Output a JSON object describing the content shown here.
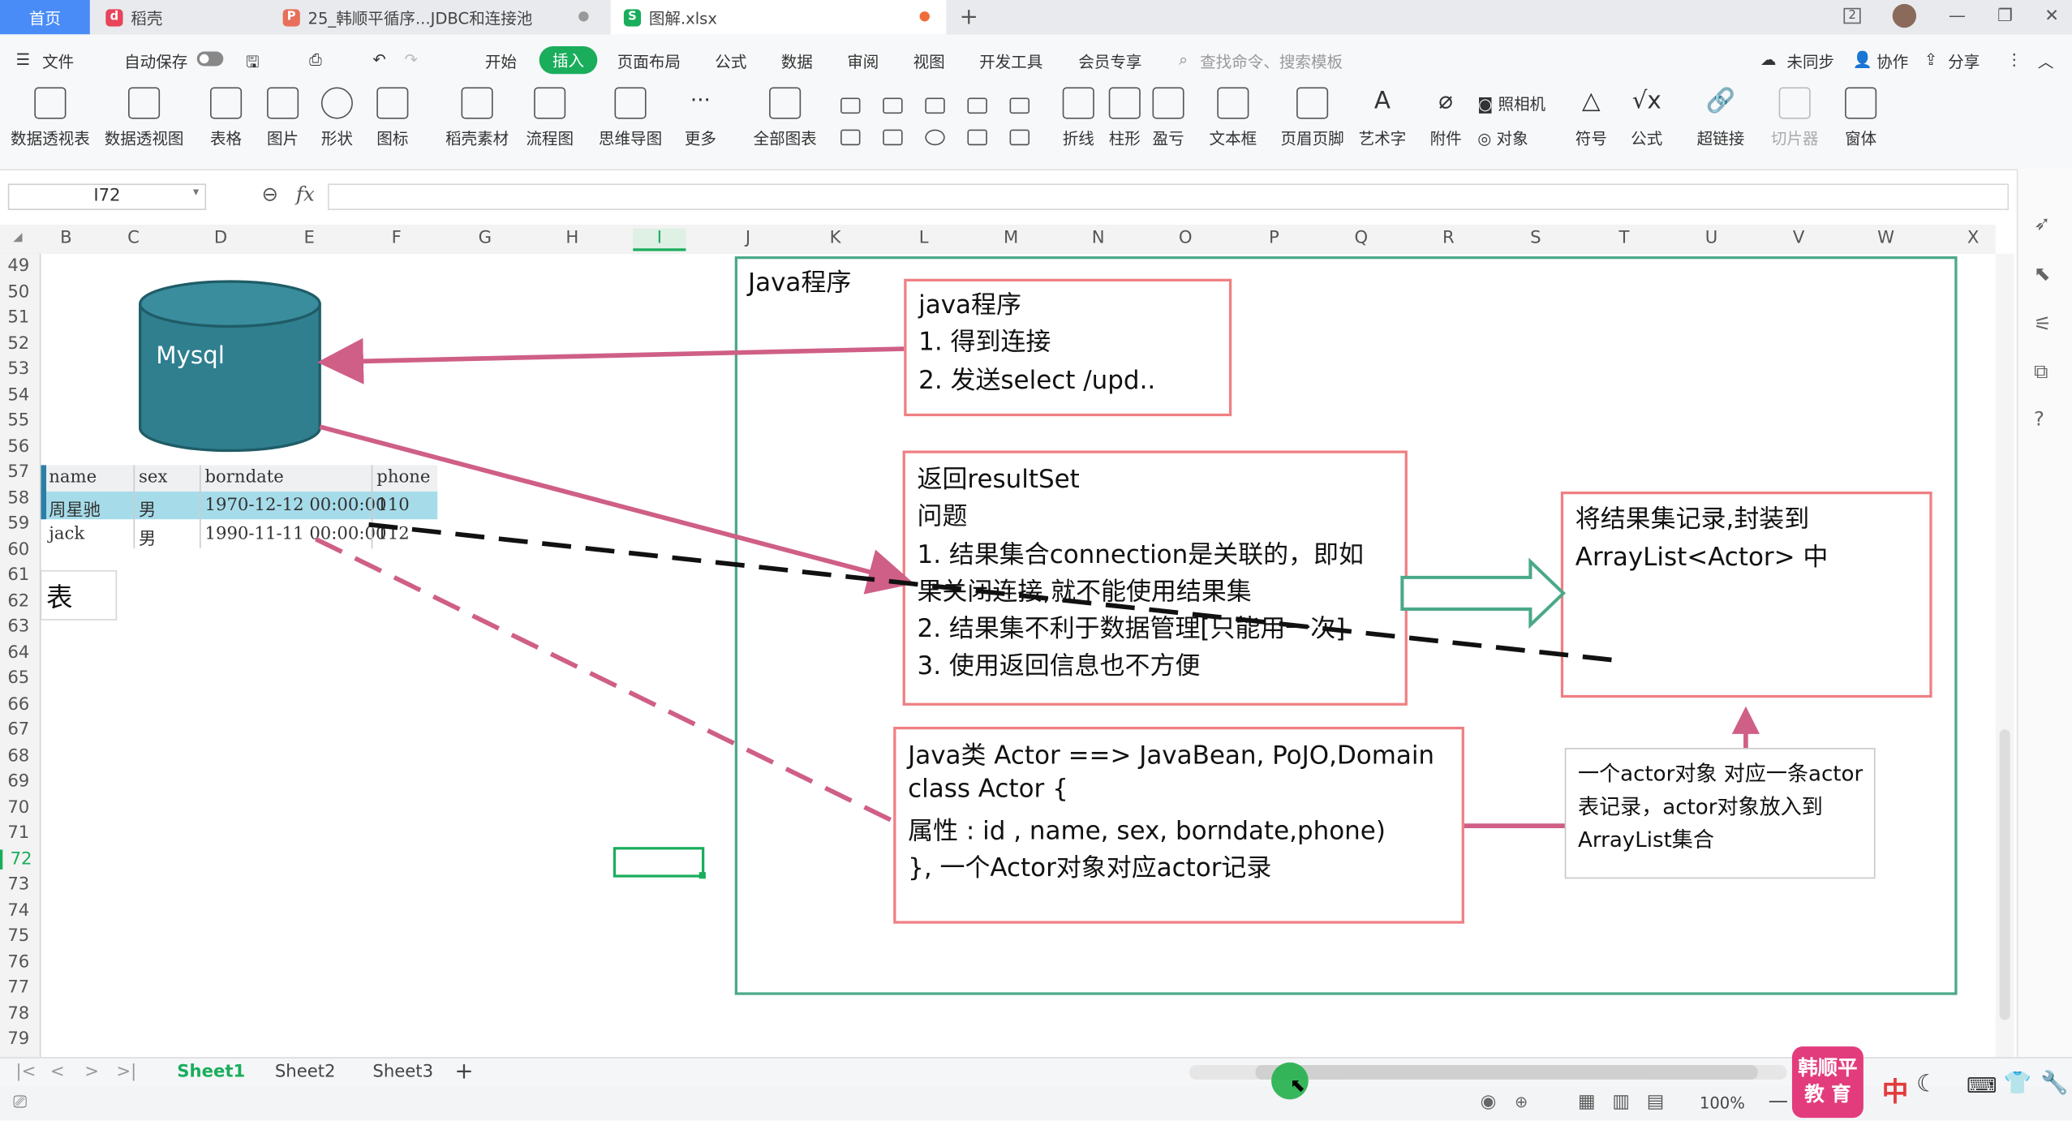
{
  "tabs": {
    "home": "首页",
    "daoke": "稻壳",
    "ppt": "25_韩顺平循序...JDBC和连接池",
    "xls": "图解.xlsx"
  },
  "menu": {
    "file": "文件",
    "autosave": "自动保存",
    "items": [
      "开始",
      "插入",
      "页面布局",
      "公式",
      "数据",
      "审阅",
      "视图",
      "开发工具",
      "会员专享"
    ],
    "search": "查找命令、搜索模板",
    "unsync": "未同步",
    "collab": "协作",
    "share": "分享"
  },
  "ribbon": {
    "pivot_table": "数据透视表",
    "pivot_view": "数据透视图",
    "table": "表格",
    "picture": "图片",
    "shape": "形状",
    "icon": "图标",
    "daoke_mat": "稻壳素材",
    "flowchart": "流程图",
    "mindmap": "思维导图",
    "more": "更多",
    "all_charts": "全部图表",
    "line": "折线",
    "column": "柱形",
    "winloss": "盈亏",
    "textbox": "文本框",
    "header_footer": "页眉页脚",
    "wordart": "艺术字",
    "attachment": "附件",
    "camera": "照相机",
    "object": "对象",
    "symbol": "符号",
    "formula": "公式",
    "hyperlink": "超链接",
    "slicer": "切片器",
    "form": "窗体"
  },
  "formula_bar": {
    "cell_ref": "I72",
    "fx": "fx",
    "value": ""
  },
  "columns": [
    "B",
    "C",
    "D",
    "E",
    "F",
    "G",
    "H",
    "I",
    "J",
    "K",
    "L",
    "M",
    "N",
    "O",
    "P",
    "Q",
    "R",
    "S",
    "T",
    "U",
    "V",
    "W",
    "X"
  ],
  "rows": [
    "49",
    "50",
    "51",
    "52",
    "53",
    "54",
    "55",
    "56",
    "57",
    "58",
    "59",
    "60",
    "61",
    "62",
    "63",
    "64",
    "65",
    "66",
    "67",
    "68",
    "69",
    "70",
    "71",
    "72",
    "73",
    "74",
    "75",
    "76",
    "77",
    "78",
    "79"
  ],
  "diagram": {
    "mysql_label": "Mysql",
    "table_headers": [
      "name",
      "sex",
      "borndate",
      "phone"
    ],
    "table_rows": [
      [
        "周星驰",
        "男",
        "1970-12-12 00:00:00",
        "110"
      ],
      [
        "jack",
        "男",
        "1990-11-11 00:00:00",
        "112"
      ]
    ],
    "table_label": "表",
    "java_frame_title": "Java程序",
    "box1": [
      "java程序",
      "1. 得到连接",
      "2. 发送select /upd.."
    ],
    "box2": [
      "返回resultSet",
      "问题",
      "1. 结果集合connection是关联的，即如",
      "果关闭连接,就不能使用结果集",
      "2. 结果集不利于数据管理[只能用一次]",
      "3. 使用返回信息也不方便"
    ],
    "box3": [
      "将结果集记录,封装到",
      "ArrayList<Actor> 中"
    ],
    "box4": [
      "Java类 Actor  ==> JavaBean, PoJO,Domain",
      "class Actor {",
      "属性 : id , name, sex, borndate,phone)",
      "}, 一个Actor对象对应actor记录"
    ],
    "note": [
      "一个actor对象 对应一条actor",
      "表记录，actor对象放入到",
      "ArrayList集合"
    ]
  },
  "sheets": [
    "Sheet1",
    "Sheet2",
    "Sheet3"
  ],
  "status": {
    "zoom": "100%",
    "lang": "中",
    "brand": [
      "韩顺平",
      "教 育"
    ]
  },
  "colors": {
    "accent_green": "#1aad5c",
    "teal_cylinder": "#2f7f8f",
    "pink_arrow": "#cf5f87",
    "box_border": "#ef7f82",
    "frame_border": "#4aa987"
  }
}
